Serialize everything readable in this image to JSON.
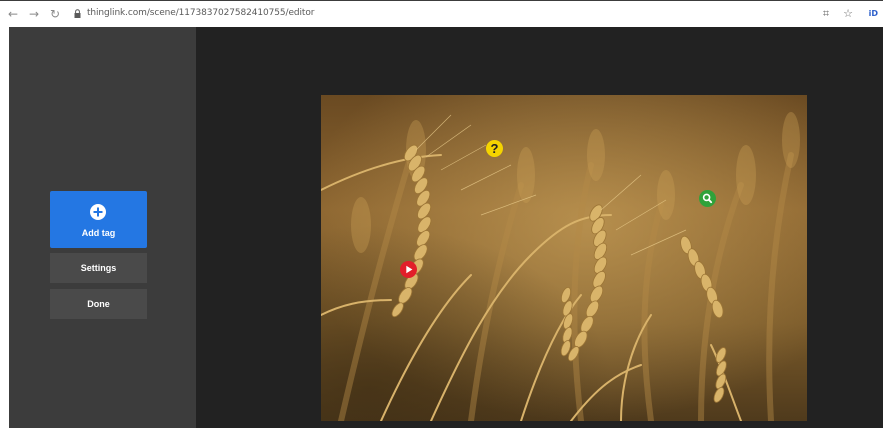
{
  "browser": {
    "url": "thinglink.com/scene/1173837027582410755/editor",
    "back_icon": "arrow-left",
    "forward_icon": "arrow-right",
    "reload_icon": "reload",
    "ext_id_label": "iD"
  },
  "sidebar": {
    "add_tag_label": "Add tag",
    "settings_label": "Settings",
    "done_label": "Done"
  },
  "tags": [
    {
      "type": "question",
      "glyph": "?",
      "color": "#f5d400"
    },
    {
      "type": "search",
      "color": "#2fa23a"
    },
    {
      "type": "play",
      "color": "#e21e2a"
    }
  ],
  "colors": {
    "accent": "#2477e3",
    "sidebar": "#3c3c3c",
    "canvas": "#222222"
  }
}
